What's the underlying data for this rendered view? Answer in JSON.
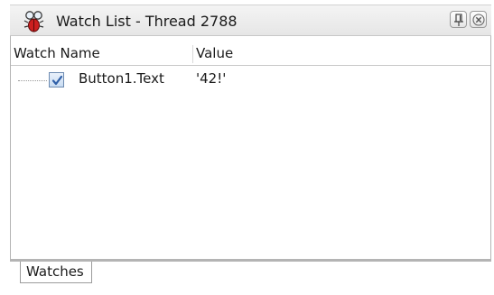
{
  "window": {
    "title": "Watch List - Thread 2788",
    "title_icon": "bug-icon"
  },
  "title_buttons": {
    "pin_icon": "pin-icon",
    "close_icon": "close-icon"
  },
  "columns": {
    "name": "Watch Name",
    "value": "Value"
  },
  "watches": [
    {
      "checked": true,
      "name": "Button1.Text",
      "value": "'42!'"
    }
  ],
  "tabs": [
    {
      "label": "Watches",
      "active": true
    }
  ],
  "colors": {
    "bug_red": "#cc1f1f",
    "check_blue": "#2f5fa8"
  }
}
